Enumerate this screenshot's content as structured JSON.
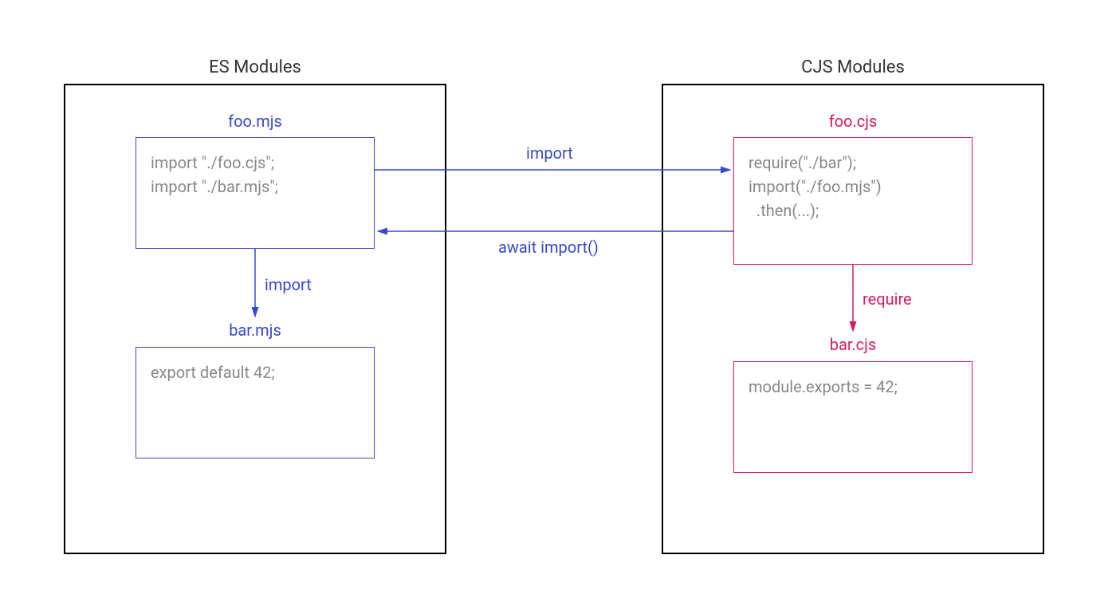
{
  "es": {
    "title": "ES Modules",
    "foo": {
      "filename": "foo.mjs",
      "line1": "import \"./foo.cjs\";",
      "line2": "import \"./bar.mjs\";"
    },
    "bar": {
      "filename": "bar.mjs",
      "line1": "export default 42;"
    },
    "arrow_label": "import"
  },
  "cjs": {
    "title": "CJS Modules",
    "foo": {
      "filename": "foo.cjs",
      "line1": "require(\"./bar\");",
      "line2": "import(\"./foo.mjs\")",
      "line3": "  .then(...);"
    },
    "bar": {
      "filename": "bar.cjs",
      "line1": "module.exports = 42;"
    },
    "arrow_label": "require"
  },
  "cross": {
    "import_label": "import",
    "await_import_label": "await import()"
  }
}
